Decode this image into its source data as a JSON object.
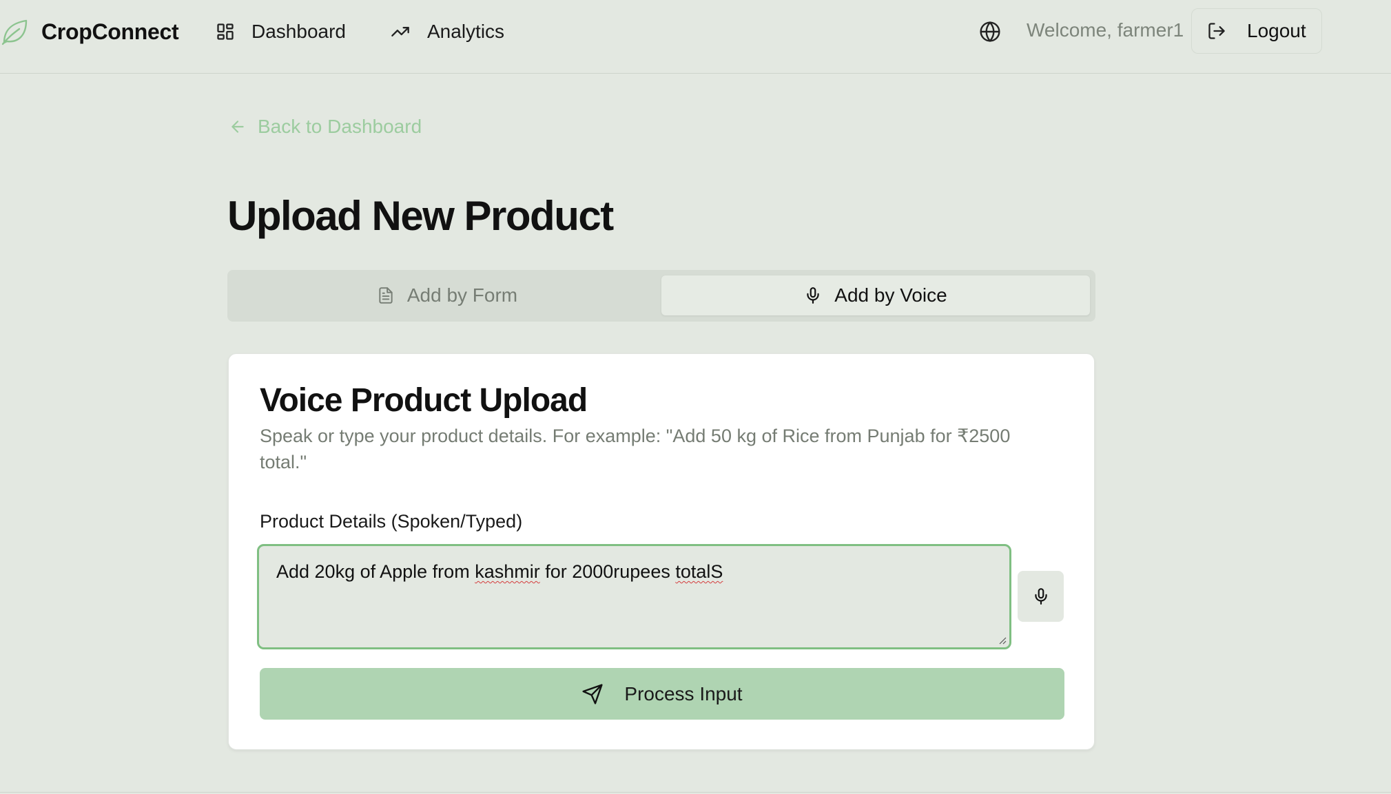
{
  "header": {
    "brand": "CropConnect",
    "nav": [
      {
        "label": "Dashboard",
        "icon": "dashboard-grid-icon"
      },
      {
        "label": "Analytics",
        "icon": "trending-up-icon"
      }
    ],
    "welcome": "Welcome, farmer1",
    "logout_label": "Logout"
  },
  "back_link": "Back to Dashboard",
  "page_title": "Upload New Product",
  "tabs": [
    {
      "label": "Add by Form",
      "icon": "file-text-icon",
      "active": false
    },
    {
      "label": "Add by Voice",
      "icon": "microphone-icon",
      "active": true
    }
  ],
  "voice_card": {
    "title": "Voice Product Upload",
    "description": "Speak or type your product details. For example: \"Add 50 kg of Rice from Punjab for ₹2500 total.\"",
    "field_label": "Product Details (Spoken/Typed)",
    "input_value_parts": {
      "a": "Add 20kg of Apple from ",
      "b": "kashmir",
      "c": " for 2000rupees ",
      "d": "totalS"
    },
    "process_button": "Process Input"
  },
  "colors": {
    "background": "#e3e8e1",
    "accent": "#7fbf82",
    "primary_button": "#afd4b2",
    "muted_text": "#7d857b"
  }
}
